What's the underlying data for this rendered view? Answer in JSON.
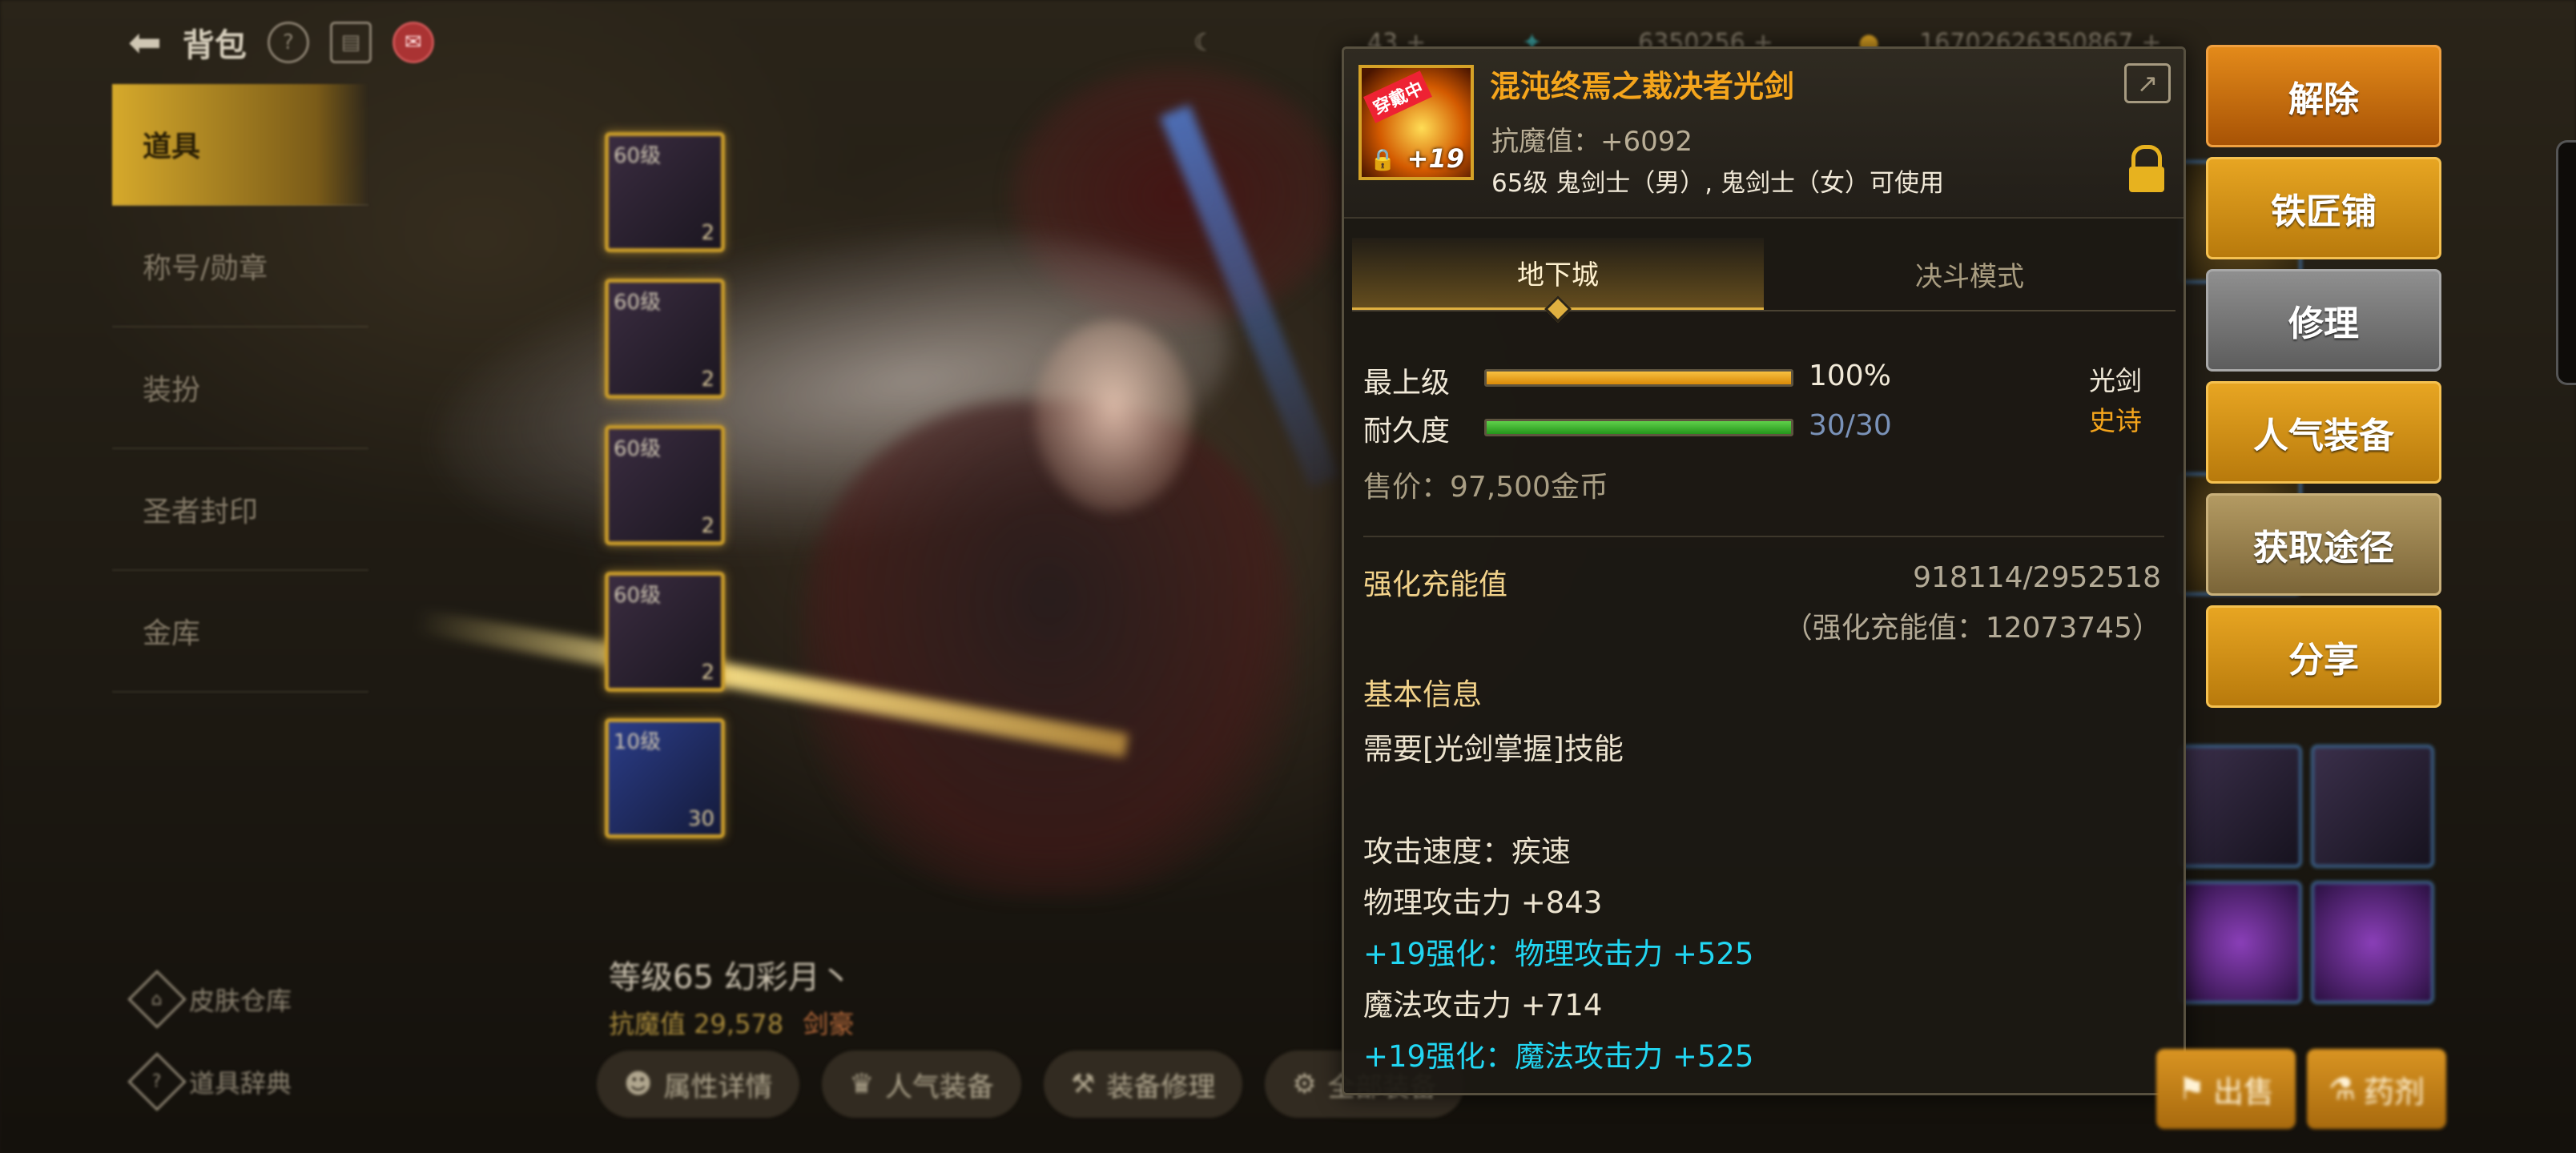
{
  "topbar": {
    "title": "背包",
    "currency": [
      {
        "icon": "moon-icon",
        "value": "43"
      },
      {
        "icon": "feather-icon",
        "value": "6350256"
      },
      {
        "icon": "gold-coin-icon",
        "value": "16702626350867"
      }
    ]
  },
  "leftnav": {
    "items": [
      {
        "label": "道具",
        "active": true
      },
      {
        "label": "称号/勋章"
      },
      {
        "label": "装扮"
      },
      {
        "label": "圣者封印"
      },
      {
        "label": "金库"
      }
    ],
    "bottom": [
      {
        "label": "皮肤仓库",
        "icon": "hanger-icon"
      },
      {
        "label": "道具辞典",
        "icon": "book-icon"
      }
    ]
  },
  "slots": [
    {
      "level": "60级",
      "count": "2"
    },
    {
      "level": "60级",
      "count": "2"
    },
    {
      "level": "60级",
      "count": "2"
    },
    {
      "level": "60级",
      "count": "2"
    },
    {
      "level": "10级",
      "count": "30"
    }
  ],
  "character": {
    "name": "等级65 幻彩月丶",
    "resist": "抗魔值 29,578",
    "tag": "剑豪"
  },
  "char_actions": [
    {
      "label": "属性详情",
      "icon": "user-icon"
    },
    {
      "label": "人气装备",
      "icon": "crown-icon"
    },
    {
      "label": "装备修理",
      "icon": "hammer-icon"
    },
    {
      "label": "全部装备",
      "icon": "gear-icon"
    }
  ],
  "tooltip": {
    "item_name": "混沌终焉之裁决者光剑",
    "item_badge": "穿戴中",
    "item_plus": "+19",
    "resist": "抗魔值：+6092",
    "requirement": "65级 鬼剑士（男）, 鬼剑士（女）可使用",
    "tabs": [
      "地下城",
      "决斗模式"
    ],
    "grade_label": "最上级",
    "grade_value": "100%",
    "grade_fraction": 1.0,
    "durability_label": "耐久度",
    "durability_value": "30/30",
    "durability_fraction": 1.0,
    "type": "光剑",
    "rarity": "史诗",
    "price": "售价：97,500金币",
    "charge_label": "强化充能值",
    "charge_value": "918114/2952518",
    "charge_total": "（强化充能值：12073745）",
    "basic_info_title": "基本信息",
    "skill_req": "需要[光剑掌握]技能",
    "attack_speed": "攻击速度：疾速",
    "phys_atk": "物理攻击力 +843",
    "phys_bonus": "+19强化：物理攻击力 +525",
    "mag_atk": "魔法攻击力 +714",
    "mag_bonus": "+19强化：魔法攻击力 +525"
  },
  "right_buttons": [
    {
      "label": "解除",
      "style": "orange"
    },
    {
      "label": "铁匠铺",
      "style": "amber"
    },
    {
      "label": "修理",
      "style": "gray"
    },
    {
      "label": "人气装备",
      "style": "amber"
    },
    {
      "label": "获取途径",
      "style": "khaki"
    },
    {
      "label": "分享",
      "style": "amber"
    }
  ],
  "bottom_buttons": [
    {
      "label": "出售",
      "icon": "bag-icon"
    },
    {
      "label": "药剂",
      "icon": "potion-icon"
    }
  ],
  "colors": {
    "accent_gold": "#f5a51c",
    "cyan_bonus": "#22d6f2",
    "grade_bar": "#f0a010",
    "durability_bar": "#35b52a"
  }
}
